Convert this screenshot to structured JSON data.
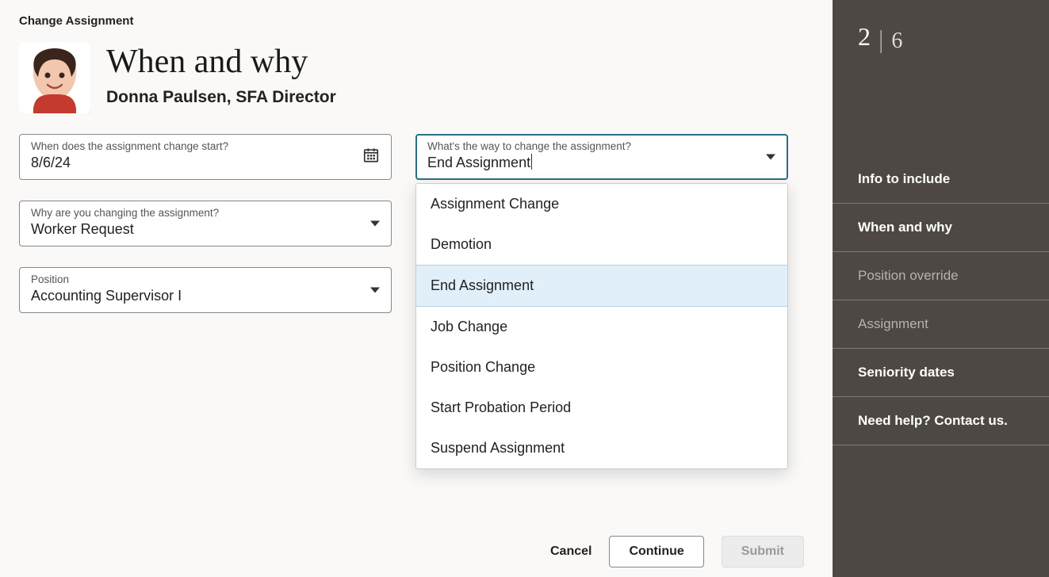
{
  "breadcrumb": "Change Assignment",
  "page_title": "When and why",
  "person": {
    "name": "Donna Paulsen",
    "title": "SFA Director",
    "display": "Donna Paulsen, SFA Director"
  },
  "fields": {
    "start_date": {
      "label": "When does the assignment change start?",
      "value": "8/6/24"
    },
    "change_way": {
      "label": "What's the way to change the assignment?",
      "value": "End Assignment",
      "options": [
        "Assignment Change",
        "Demotion",
        "End Assignment",
        "Job Change",
        "Position Change",
        "Start Probation Period",
        "Suspend Assignment"
      ]
    },
    "reason": {
      "label": "Why are you changing the assignment?",
      "value": "Worker Request"
    },
    "position": {
      "label": "Position",
      "value": "Accounting Supervisor I"
    }
  },
  "buttons": {
    "cancel": "Cancel",
    "continue": "Continue",
    "submit": "Submit"
  },
  "sidebar": {
    "step_current": "2",
    "step_total": "6",
    "items": [
      {
        "label": "Info to include",
        "state": "normal"
      },
      {
        "label": "When and why",
        "state": "active"
      },
      {
        "label": "Position override",
        "state": "dim"
      },
      {
        "label": "Assignment",
        "state": "dim"
      },
      {
        "label": "Seniority dates",
        "state": "normal"
      }
    ],
    "help": "Need help? Contact us."
  }
}
